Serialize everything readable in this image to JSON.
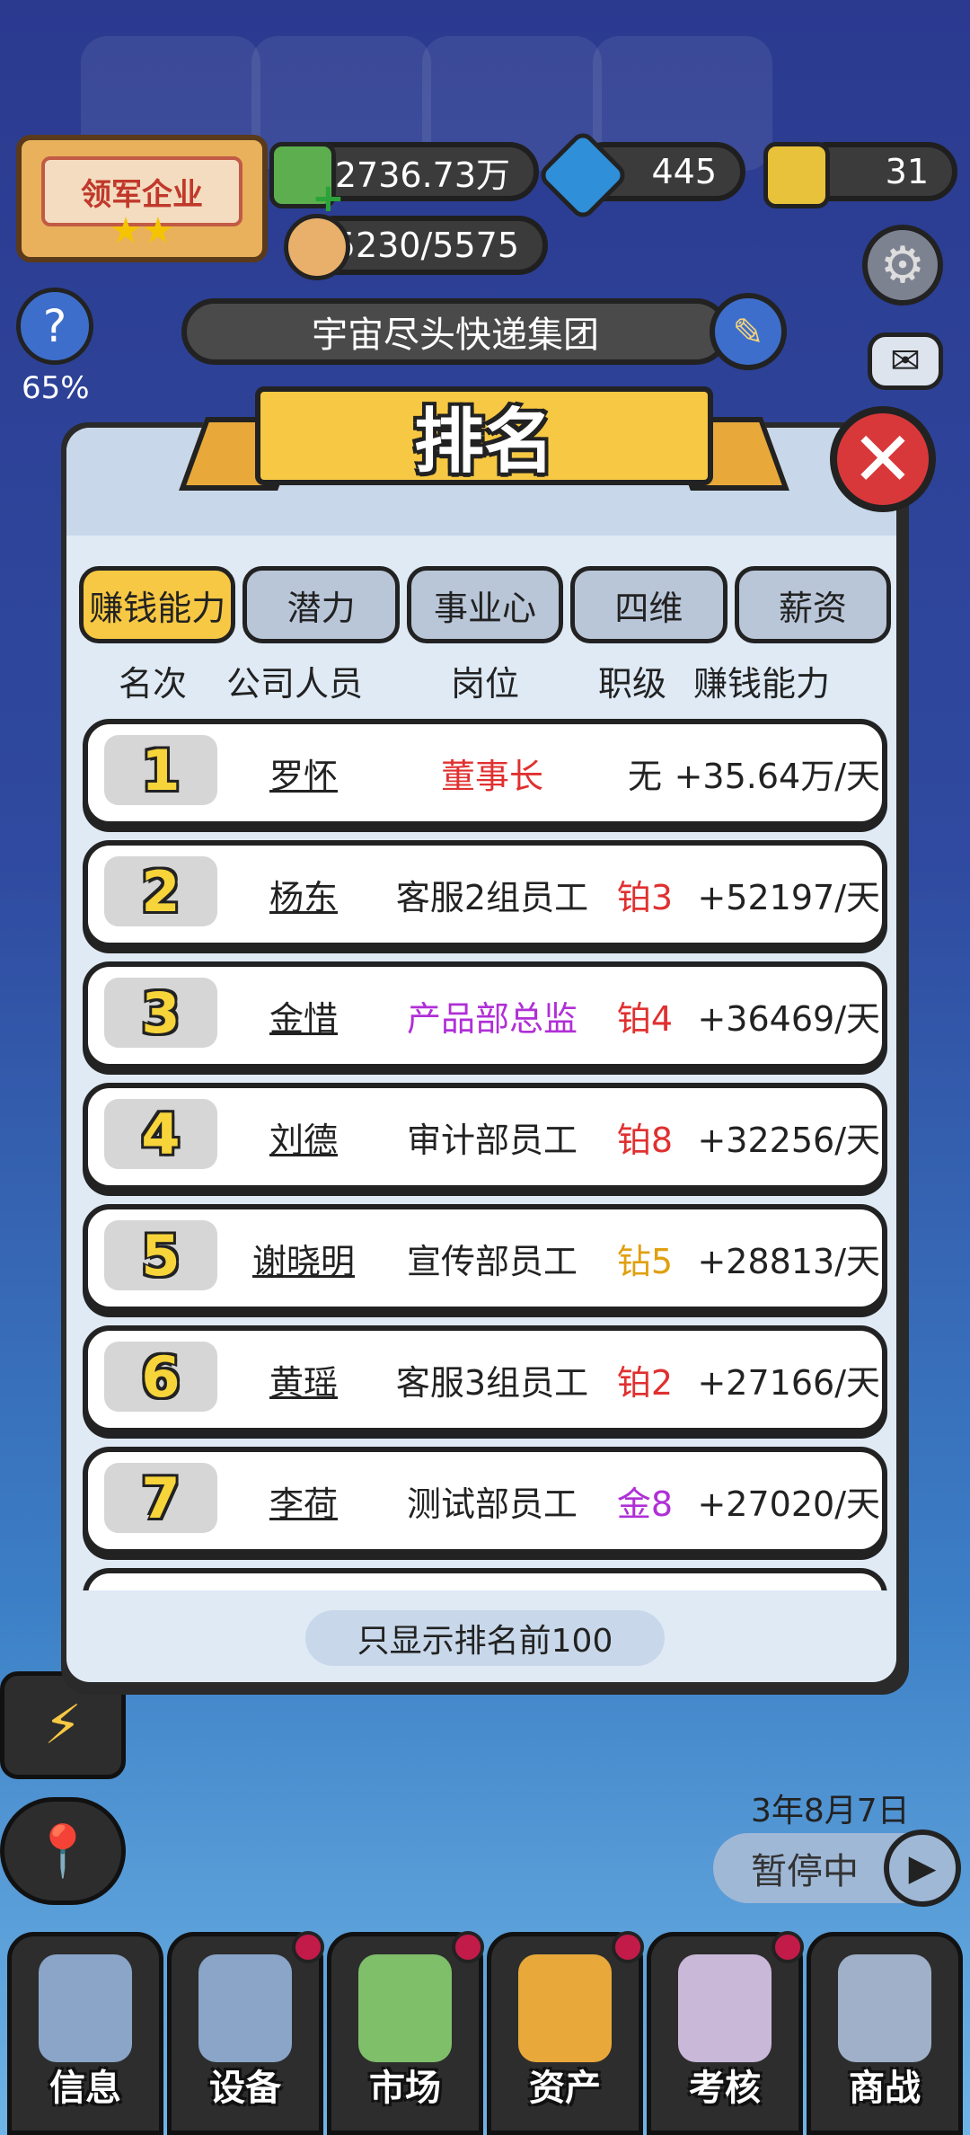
{
  "top_bar": {
    "army_badge": "领军企业",
    "money": "2736.73万",
    "diamonds": "445",
    "cards": "31",
    "reputation": "5230/5575",
    "help_percent": "65%"
  },
  "company_name": "宇宙尽头快递集团",
  "modal": {
    "title": "排名",
    "tabs": [
      "赚钱能力",
      "潜力",
      "事业心",
      "四维",
      "薪资"
    ],
    "active_tab": 0,
    "columns": [
      "名次",
      "公司人员",
      "岗位",
      "职级",
      "赚钱能力"
    ],
    "rows": [
      {
        "rank": "1",
        "name": "罗怀",
        "post": "董事长",
        "post_color": "#e03030",
        "grade": "无",
        "grade_color": "#222222",
        "earn": "+35.64万/天"
      },
      {
        "rank": "2",
        "name": "杨东",
        "post": "客服2组员工",
        "post_color": "#222222",
        "grade": "铂3",
        "grade_color": "#e03030",
        "earn": "+52197/天"
      },
      {
        "rank": "3",
        "name": "金惜",
        "post": "产品部总监",
        "post_color": "#b02fd6",
        "grade": "铂4",
        "grade_color": "#e03030",
        "earn": "+36469/天"
      },
      {
        "rank": "4",
        "name": "刘德",
        "post": "审计部员工",
        "post_color": "#222222",
        "grade": "铂8",
        "grade_color": "#e03030",
        "earn": "+32256/天"
      },
      {
        "rank": "5",
        "name": "谢晓明",
        "post": "宣传部员工",
        "post_color": "#222222",
        "grade": "钻5",
        "grade_color": "#e0a010",
        "earn": "+28813/天"
      },
      {
        "rank": "6",
        "name": "黄瑶",
        "post": "客服3组员工",
        "post_color": "#222222",
        "grade": "铂2",
        "grade_color": "#e03030",
        "earn": "+27166/天"
      },
      {
        "rank": "7",
        "name": "李荷",
        "post": "测试部员工",
        "post_color": "#222222",
        "grade": "金8",
        "grade_color": "#b02fd6",
        "earn": "+27020/天"
      }
    ],
    "footer_note": "只显示排名前100"
  },
  "game_date": "3年8月7日",
  "pause_label": "暂停中",
  "bottom_nav": [
    "信息",
    "设备",
    "市场",
    "资产",
    "考核",
    "商战"
  ]
}
